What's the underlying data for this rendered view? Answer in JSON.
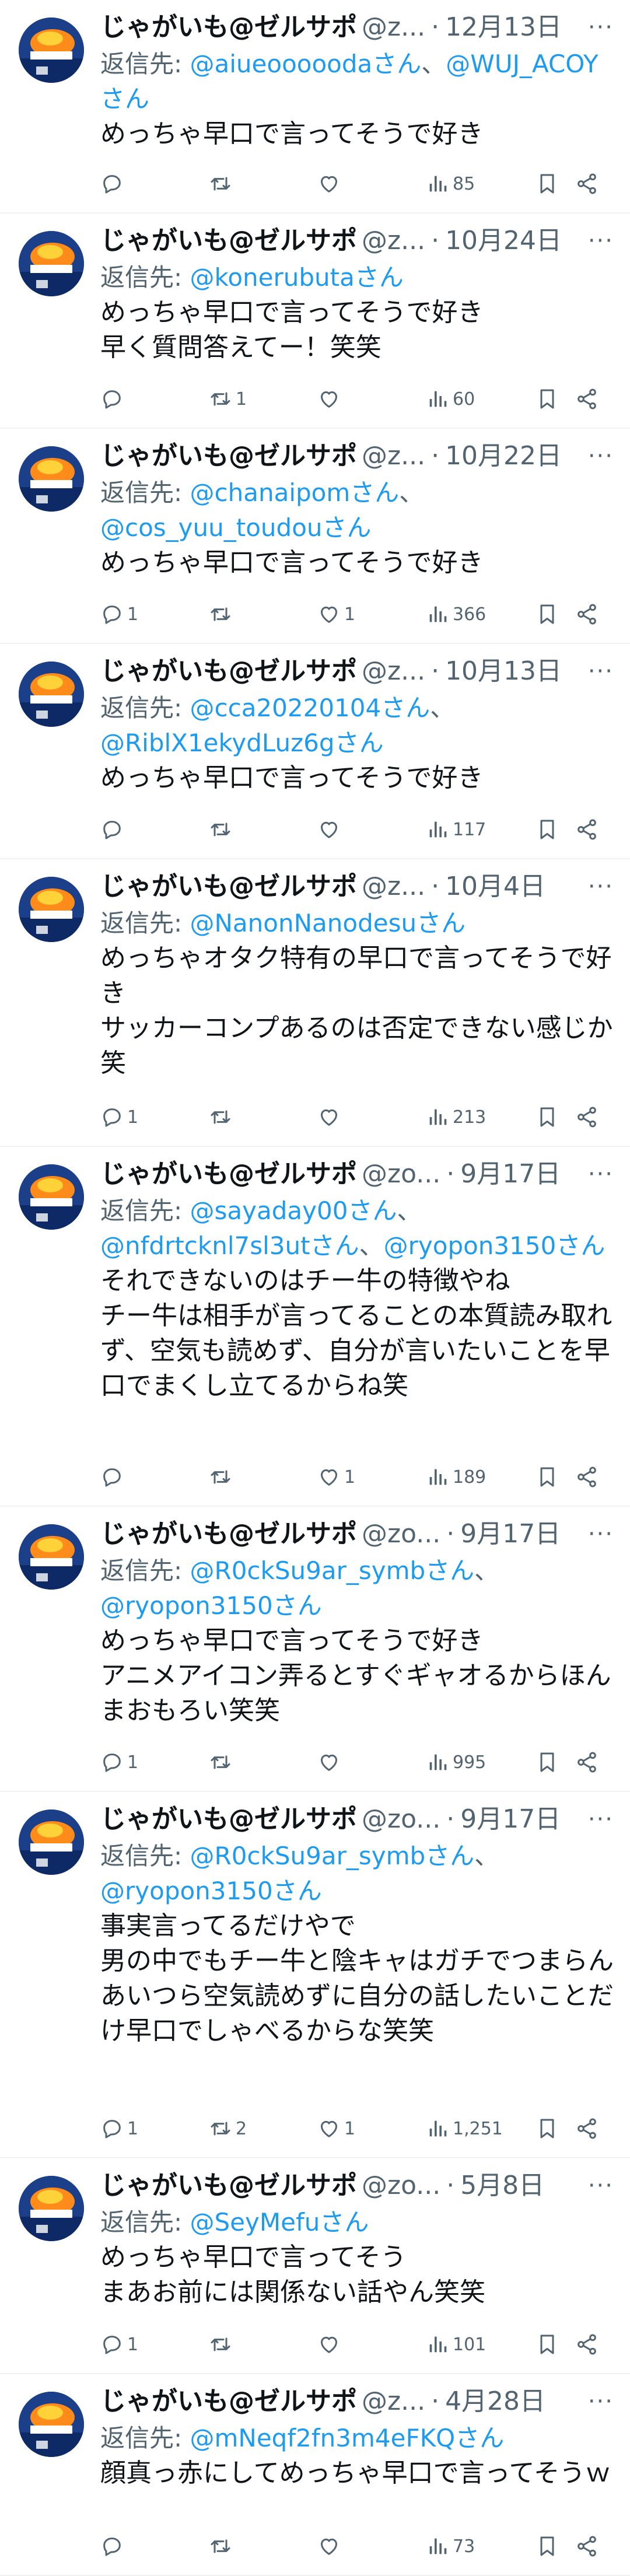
{
  "tweets": [
    {
      "name": "じゃがいも@ゼルサポ",
      "handle": "@z...",
      "date": "12月13日",
      "reply_label": "返信先: ",
      "mentions": [
        "@aiueoooooda",
        "@WUJ_ACOY"
      ],
      "text": "めっちゃ早口で言ってそうで好き",
      "replies": "",
      "retweets": "",
      "likes": "",
      "views": "85"
    },
    {
      "name": "じゃがいも@ゼルサポ",
      "handle": "@z...",
      "date": "10月24日",
      "reply_label": "返信先: ",
      "mentions": [
        "@konerubuta"
      ],
      "text": "めっちゃ早口で言ってそうで好き\n早く質問答えてー！笑笑",
      "replies": "",
      "retweets": "1",
      "likes": "",
      "views": "60"
    },
    {
      "name": "じゃがいも@ゼルサポ",
      "handle": "@z...",
      "date": "10月22日",
      "reply_label": "返信先: ",
      "mentions": [
        "@chanaipom",
        "@cos_yuu_toudou"
      ],
      "text": "めっちゃ早口で言ってそうで好き",
      "replies": "1",
      "retweets": "",
      "likes": "1",
      "views": "366"
    },
    {
      "name": "じゃがいも@ゼルサポ",
      "handle": "@z...",
      "date": "10月13日",
      "reply_label": "返信先: ",
      "mentions": [
        "@cca20220104",
        "@RiblX1ekydLuz6g"
      ],
      "text": "めっちゃ早口で言ってそうで好き",
      "replies": "",
      "retweets": "",
      "likes": "",
      "views": "117"
    },
    {
      "name": "じゃがいも@ゼルサポ",
      "handle": "@z...",
      "date": "10月4日",
      "reply_label": "返信先: ",
      "mentions": [
        "@NanonNanodesu"
      ],
      "text": "めっちゃオタク特有の早口で言ってそうで好き\nサッカーコンプあるのは否定できない感じか笑",
      "replies": "1",
      "retweets": "",
      "likes": "",
      "views": "213"
    },
    {
      "name": "じゃがいも@ゼルサポ",
      "handle": "@zo...",
      "date": "9月17日",
      "reply_label": "返信先: ",
      "mentions": [
        "@sayaday00",
        "@nfdrtcknl7sl3ut",
        "@ryopon3150"
      ],
      "text": "それできないのはチー牛の特徴やね\nチー牛は相手が言ってることの本質読み取れず、空気も読めず、自分が言いたいことを早口でまくし立てるからね笑",
      "replies": "",
      "retweets": "",
      "likes": "1",
      "views": "189"
    },
    {
      "name": "じゃがいも@ゼルサポ",
      "handle": "@zo...",
      "date": "9月17日",
      "reply_label": "返信先: ",
      "mentions": [
        "@R0ckSu9ar_symb",
        "@ryopon3150"
      ],
      "text": "めっちゃ早口で言ってそうで好き\nアニメアイコン弄るとすぐギャオるからほんまおもろい笑笑",
      "replies": "1",
      "retweets": "",
      "likes": "",
      "views": "995"
    },
    {
      "name": "じゃがいも@ゼルサポ",
      "handle": "@zo...",
      "date": "9月17日",
      "reply_label": "返信先: ",
      "mentions": [
        "@R0ckSu9ar_symb",
        "@ryopon3150"
      ],
      "text": "事実言ってるだけやで\n男の中でもチー牛と陰キャはガチでつまらん\nあいつら空気読めずに自分の話したいことだけ早口でしゃべるからな笑笑",
      "replies": "1",
      "retweets": "2",
      "likes": "1",
      "views": "1,251"
    },
    {
      "name": "じゃがいも@ゼルサポ",
      "handle": "@zo...",
      "date": "5月8日",
      "reply_label": "返信先: ",
      "mentions": [
        "@SeyMefu"
      ],
      "text": "めっちゃ早口で言ってそう\nまあお前には関係ない話やん笑笑",
      "replies": "1",
      "retweets": "",
      "likes": "",
      "views": "101"
    },
    {
      "name": "じゃがいも@ゼルサポ",
      "handle": "@z...",
      "date": "4月28日",
      "reply_label": "返信先: ",
      "mentions": [
        "@mNeqf2fn3m4eFKQ"
      ],
      "text": "顔真っ赤にしてめっちゃ早口で言ってそうｗ",
      "replies": "",
      "retweets": "",
      "likes": "",
      "views": "73"
    }
  ],
  "mention_suffix": "さん",
  "mention_separator": "、",
  "more_label": "···",
  "colors": {
    "text": "#0f1419",
    "muted": "#536471",
    "link": "#1d9bf0",
    "divider": "#eff3f4",
    "avatar_bg": "#1c3f8a"
  },
  "icons": {
    "reply": "reply-icon",
    "retweet": "retweet-icon",
    "like": "like-icon",
    "views": "views-icon",
    "bookmark": "bookmark-icon",
    "share": "share-icon",
    "more": "more-icon"
  }
}
